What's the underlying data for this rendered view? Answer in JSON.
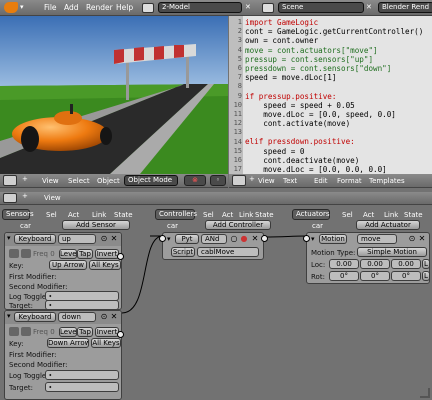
{
  "menubar": {
    "items": [
      "File",
      "Add",
      "Render",
      "Help"
    ],
    "screen": "2-Model",
    "scene": "Scene",
    "engine": "Blender Rend"
  },
  "viewport_header": {
    "items": [
      "View",
      "Select",
      "Object"
    ],
    "mode": "Object Mode"
  },
  "text_editor": {
    "line_numbers": [
      "1",
      "2",
      "3",
      "4",
      "5",
      "6",
      "7",
      "8",
      "9",
      "10",
      "11",
      "12",
      "13",
      "14",
      "15",
      "16",
      "17"
    ],
    "lines": [
      {
        "t": "import GameLogic",
        "c": "kw"
      },
      {
        "t": "cont = GameLogic.getCurrentController()",
        "c": "n"
      },
      {
        "t": "own = cont.owner",
        "c": "n"
      },
      {
        "t": "move = cont.actuators[\"move\"]",
        "c": "s"
      },
      {
        "t": "pressup = cont.sensors[\"up\"]",
        "c": "s"
      },
      {
        "t": "pressdown = cont.sensors[\"down\"]",
        "c": "s"
      },
      {
        "t": "speed = move.dLoc[1]",
        "c": "n"
      },
      {
        "t": "",
        "c": "n"
      },
      {
        "t": "if pressup.positive:",
        "c": "kw"
      },
      {
        "t": "    speed = speed + 0.05",
        "c": "n"
      },
      {
        "t": "    move.dLoc = [0.0, speed, 0.0]",
        "c": "n"
      },
      {
        "t": "    cont.activate(move)",
        "c": "n"
      },
      {
        "t": "",
        "c": "n"
      },
      {
        "t": "elif pressdown.positive:",
        "c": "kw"
      },
      {
        "t": "    speed = 0",
        "c": "n"
      },
      {
        "t": "    cont.deactivate(move)",
        "c": "n"
      },
      {
        "t": "    move.dLoc = [0.0, 0.0, 0.0]",
        "c": "n"
      }
    ],
    "colors": {
      "kw": "#c00000",
      "s": "#1f6e1f",
      "n": "#000000",
      "num": "#0000c0"
    }
  },
  "text_header": {
    "items": [
      "View",
      "Text",
      "Edit",
      "Format",
      "Templates"
    ]
  },
  "logic_header": {
    "items": [
      "View"
    ]
  },
  "sensors": {
    "title": "Sensors",
    "filters": [
      "Sel",
      "Act",
      "Link",
      "State"
    ],
    "object": "car",
    "add": "Add Sensor",
    "blocks": [
      {
        "type": "Keyboard",
        "name": "up",
        "toggles": [
          "Level",
          "Tap",
          "Invert"
        ],
        "key_label": "Key:",
        "key": "Up Arrow",
        "all_keys": "All Keys",
        "first_mod": "First Modifier:",
        "second_mod": "Second Modifier:",
        "log": "Log Toggle:",
        "target": "Target:",
        "freq": "Freq 0"
      },
      {
        "type": "Keyboard",
        "name": "down",
        "toggles": [
          "Level",
          "Tap",
          "Invert"
        ],
        "key_label": "Key:",
        "key": "Down Arrow",
        "all_keys": "All Keys",
        "first_mod": "First Modifier:",
        "second_mod": "Second Modifier:",
        "log": "Log Toggle:",
        "target": "Target:",
        "freq": "Freq 0"
      }
    ]
  },
  "controllers": {
    "title": "Controllers",
    "filters": [
      "Sel",
      "Act",
      "Link",
      "State"
    ],
    "object": "car",
    "add": "Add Controller",
    "block": {
      "type": "Pyt",
      "name": "ANd",
      "script_label": "Script",
      "script": "cablMove"
    }
  },
  "actuators": {
    "title": "Actuators",
    "filters": [
      "Sel",
      "Act",
      "Link",
      "State"
    ],
    "object": "car",
    "add": "Add Actuator",
    "block": {
      "type": "Motion",
      "name": "move",
      "motion_label": "Motion Type:",
      "motion": "Simple Motion",
      "loc": "Loc:",
      "rot": "Rot:",
      "loc_vals": [
        "0.00",
        "0.00",
        "0.00"
      ],
      "rot_vals": [
        "0°",
        "0°",
        "0°"
      ],
      "l": "L"
    }
  }
}
